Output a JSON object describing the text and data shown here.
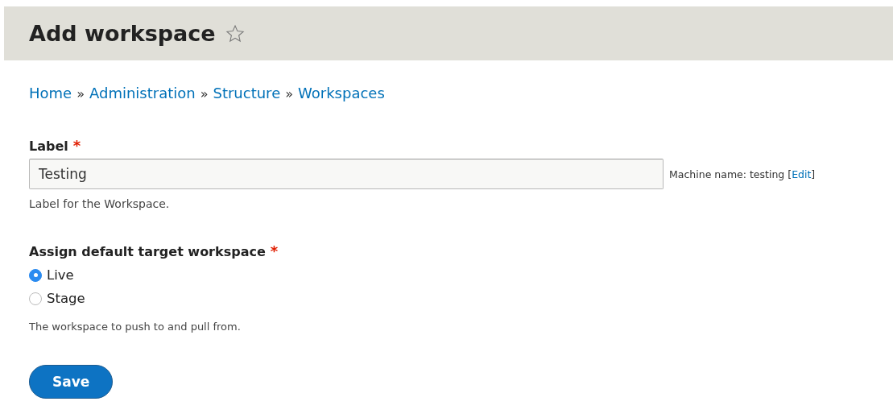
{
  "header": {
    "title": "Add workspace",
    "starred": false
  },
  "breadcrumb": {
    "separator": "»",
    "items": [
      "Home",
      "Administration",
      "Structure",
      "Workspaces"
    ]
  },
  "label_field": {
    "label": "Label",
    "required_mark": "*",
    "value": "Testing",
    "machine_name": {
      "prefix": "Machine name: testing [",
      "link": "Edit",
      "suffix": "]"
    },
    "description": "Label for the Workspace."
  },
  "target_field": {
    "label": "Assign default target workspace",
    "required_mark": "*",
    "options": [
      {
        "label": "Live",
        "selected": true
      },
      {
        "label": "Stage",
        "selected": false
      }
    ],
    "description": "The workspace to push to and pull from."
  },
  "buttons": [
    {
      "label": "Save",
      "kind": "primary"
    }
  ]
}
